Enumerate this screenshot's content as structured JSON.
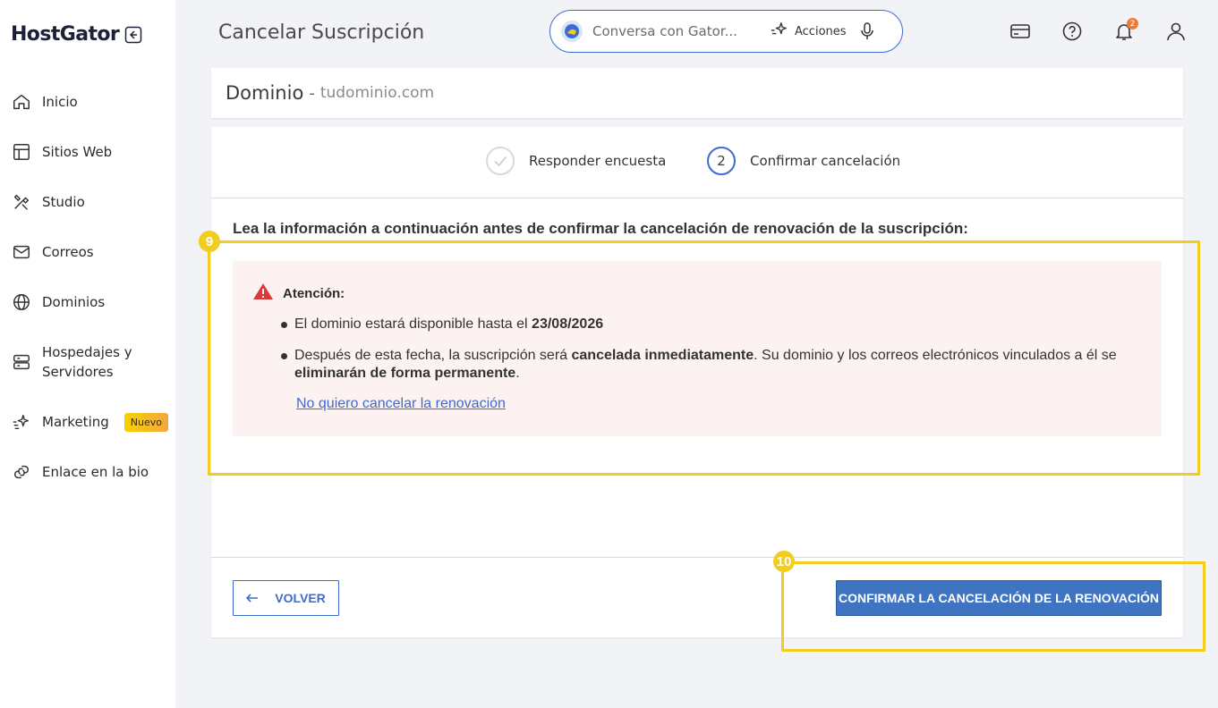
{
  "brand": {
    "name": "HostGator"
  },
  "sidebar": {
    "items": [
      {
        "label": "Inicio",
        "icon": "home-icon"
      },
      {
        "label": "Sitios Web",
        "icon": "layout-icon"
      },
      {
        "label": "Studio",
        "icon": "studio-tools-icon"
      },
      {
        "label": "Correos",
        "icon": "mail-icon"
      },
      {
        "label": "Dominios",
        "icon": "globe-icon"
      },
      {
        "label": "Hospedajes y\nServidores",
        "icon": "server-icon"
      },
      {
        "label": "Marketing",
        "icon": "sparkle-icon",
        "badge": "Nuevo"
      },
      {
        "label": "Enlace en la bio",
        "icon": "link-icon"
      }
    ]
  },
  "header": {
    "title": "Cancelar Suscripción",
    "chat": {
      "placeholder": "Conversa con Gator...",
      "actions_label": "Acciones"
    },
    "notifications_count": "2"
  },
  "domain": {
    "label": "Dominio",
    "separator": "-",
    "name": "tudominio.com"
  },
  "steps": [
    {
      "label": "Responder encuesta",
      "state": "done"
    },
    {
      "number": "2",
      "label": "Confirmar cancelación",
      "state": "current"
    }
  ],
  "intro": "Lea la información a continuación antes de confirmar la cancelación de renovación de la suscripción:",
  "alert": {
    "title": "Atención:",
    "bullet1_prefix": "El dominio estará disponible hasta el ",
    "bullet1_date": "23/08/2026",
    "bullet2_prefix": "Después de esta fecha, la suscripción será ",
    "bullet2_bold1": "cancelada inmediatamente",
    "bullet2_mid": ". Su dominio y los correos electrónicos vinculados a él se ",
    "bullet2_bold2": "eliminarán de forma permanente",
    "bullet2_suffix": ".",
    "link": "No quiero cancelar la renovación"
  },
  "buttons": {
    "back": "VOLVER",
    "confirm": "CONFIRMAR LA CANCELACIÓN DE LA RENOVACIÓN"
  },
  "annotations": [
    {
      "number": "9"
    },
    {
      "number": "10"
    }
  ],
  "colors": {
    "primary": "#3f74c3",
    "accent_link": "#3d6bd1",
    "highlight": "#f2cc1f",
    "alert_bg": "#fdf2f2",
    "warning": "#d83a3a"
  }
}
